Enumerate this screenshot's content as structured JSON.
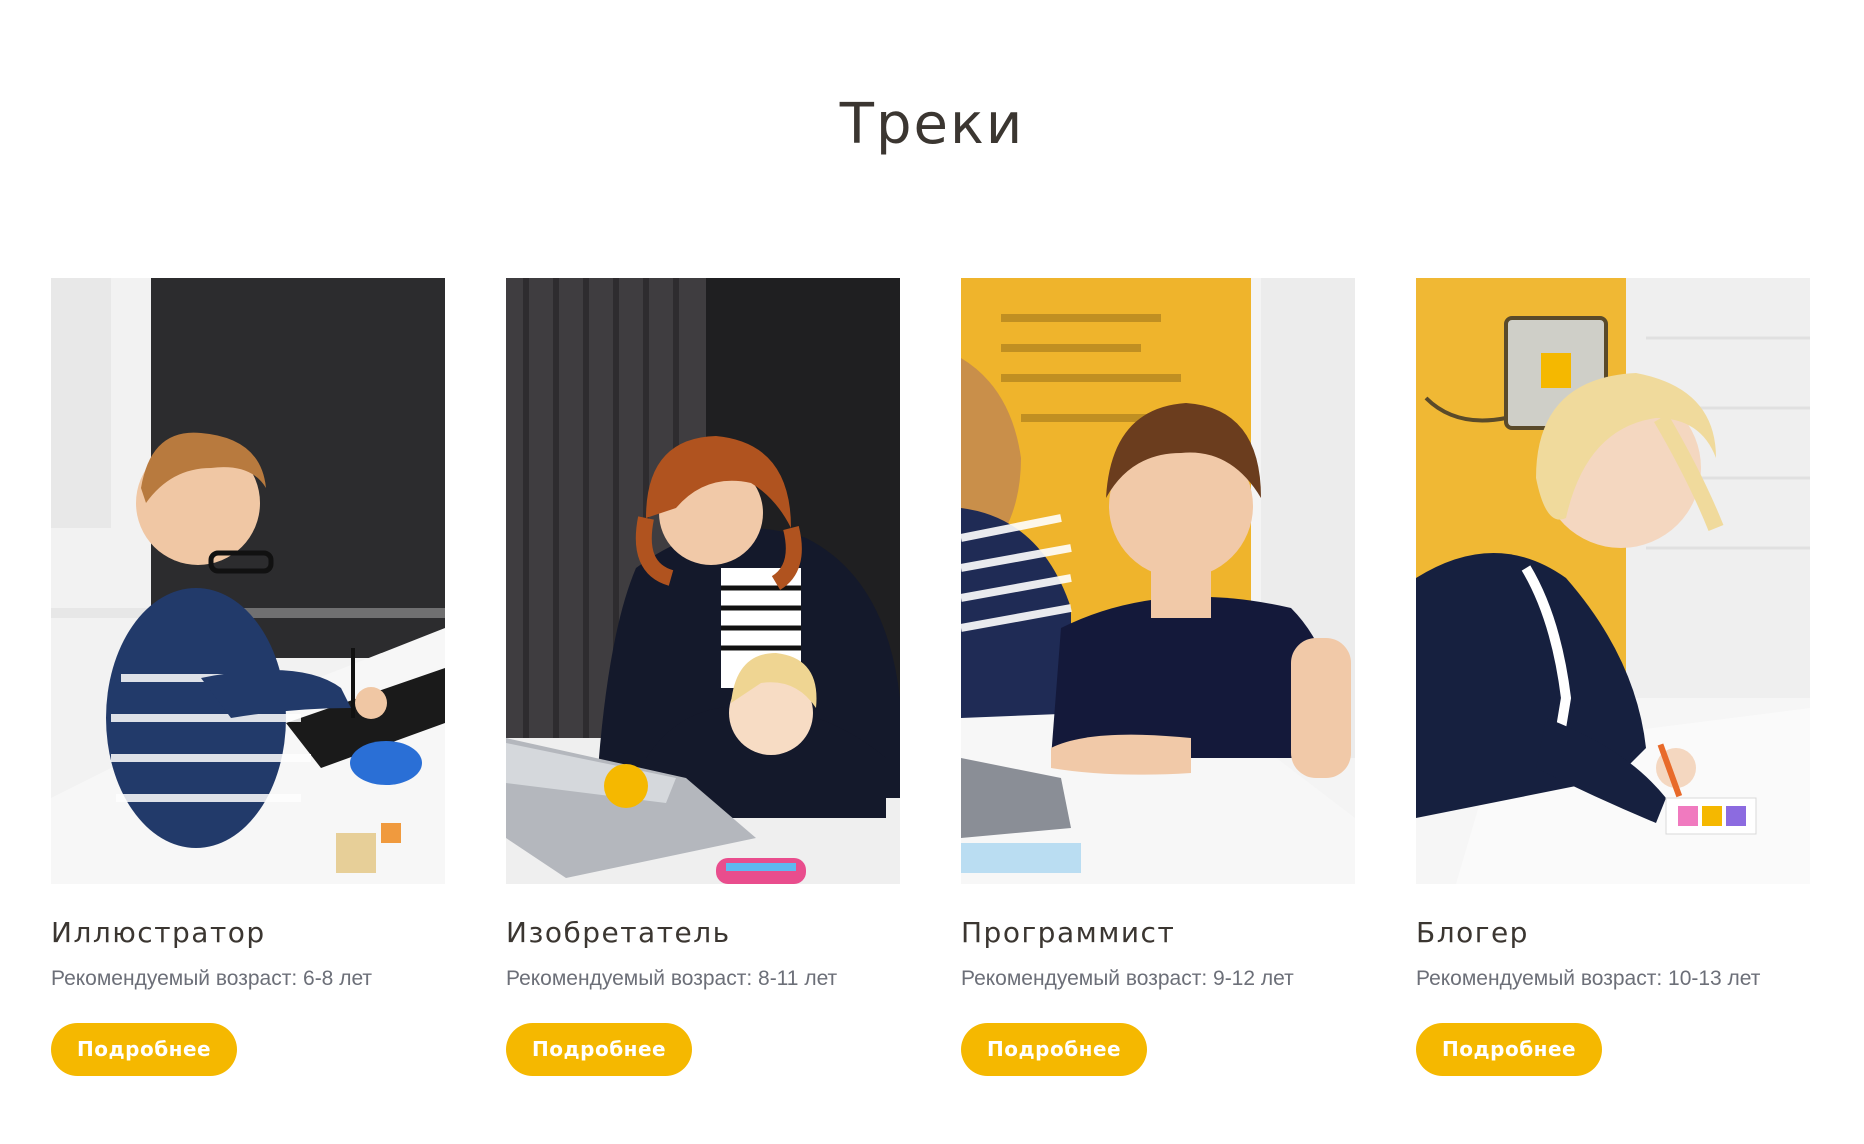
{
  "page": {
    "title": "Треки"
  },
  "tracks": [
    {
      "title": "Иллюстратор",
      "age": "Рекомендуемый возраст: 6-8 лет",
      "button": "Подробнее",
      "image": "boy-with-glasses-drawing-on-tablet"
    },
    {
      "title": "Изобретатель",
      "age": "Рекомендуемый возраст: 8-11 лет",
      "button": "Подробнее",
      "image": "teacher-and-girl-at-laptop"
    },
    {
      "title": "Программист",
      "age": "Рекомендуемый возраст: 9-12 лет",
      "button": "Подробнее",
      "image": "boy-at-desk-in-front-of-yellow-banner"
    },
    {
      "title": "Блогер",
      "age": "Рекомендуемый возраст: 10-13 лет",
      "button": "Подробнее",
      "image": "girl-drawing-with-pencil"
    }
  ],
  "colors": {
    "accent": "#f5b800",
    "heading": "#3b3631",
    "muted": "#6c6f78"
  }
}
